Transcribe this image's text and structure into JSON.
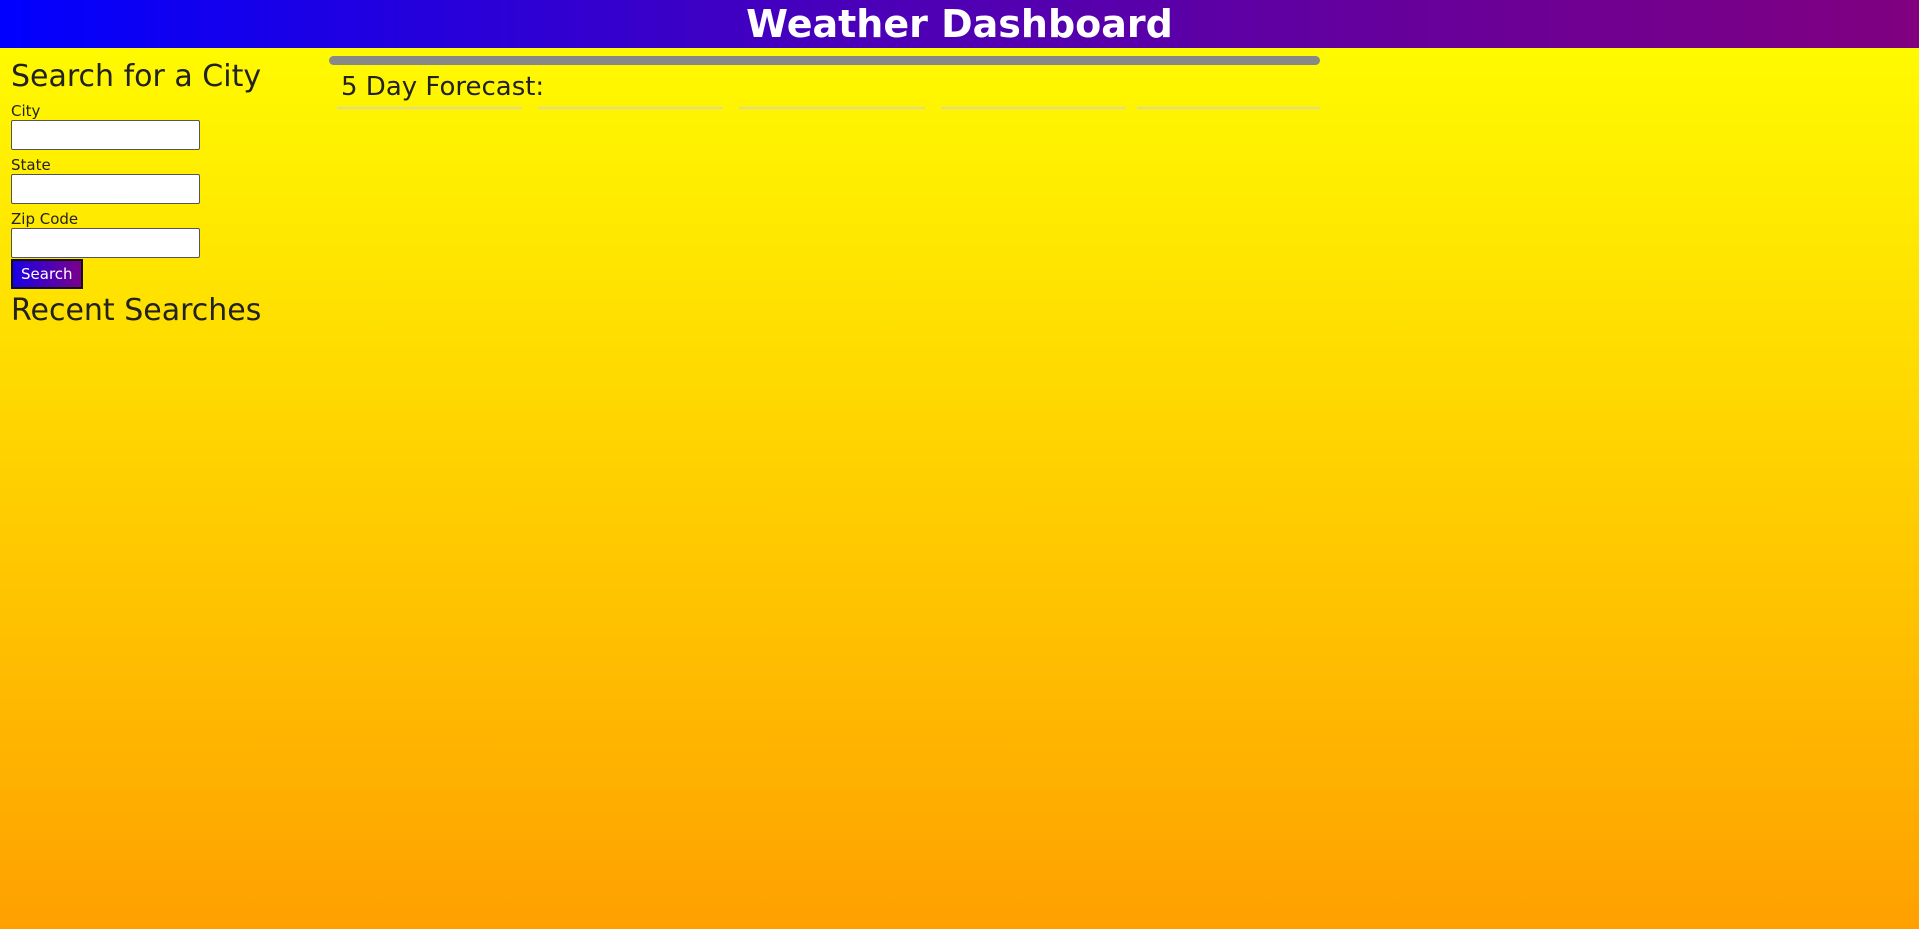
{
  "header": {
    "title": "Weather Dashboard"
  },
  "sidebar": {
    "heading": "Search for a City",
    "fields": {
      "city": {
        "label": "City",
        "value": "",
        "placeholder": ""
      },
      "state": {
        "label": "State",
        "value": "",
        "placeholder": ""
      },
      "zip": {
        "label": "Zip Code",
        "value": "",
        "placeholder": ""
      }
    },
    "search_button_label": "Search",
    "recent_heading": "Recent Searches"
  },
  "main": {
    "forecast_heading": "5 Day Forecast:"
  },
  "colors": {
    "header_gradient_start": "#0000ff",
    "header_gradient_end": "#800080",
    "background_top": "#ffff00",
    "background_bottom": "#ffa000",
    "bar": "#888888"
  }
}
